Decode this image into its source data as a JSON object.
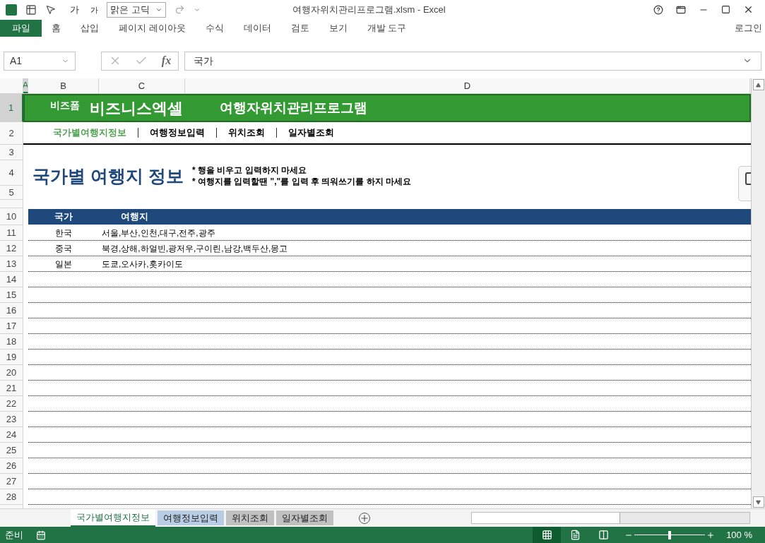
{
  "window": {
    "title": "여행자위치관리프로그램.xlsm - Excel",
    "font_box": "맑은 고딕",
    "font_size_up": "가",
    "font_size_down": "가"
  },
  "ribbon": {
    "tabs": [
      {
        "label": "파일",
        "kind": "file"
      },
      {
        "label": "홈",
        "kind": "tab"
      },
      {
        "label": "삽입",
        "kind": "tab"
      },
      {
        "label": "페이지 레이아웃",
        "kind": "tab"
      },
      {
        "label": "수식",
        "kind": "tab"
      },
      {
        "label": "데이터",
        "kind": "tab"
      },
      {
        "label": "검토",
        "kind": "tab"
      },
      {
        "label": "보기",
        "kind": "tab"
      },
      {
        "label": "개발 도구",
        "kind": "tab"
      }
    ],
    "account": "로그인"
  },
  "formula_bar": {
    "name_box": "A1",
    "function_button": "fx",
    "value": "국가"
  },
  "columns": [
    {
      "label": "A",
      "selected": true
    },
    {
      "label": "B",
      "selected": false
    },
    {
      "label": "C",
      "selected": false
    },
    {
      "label": "D",
      "selected": false
    }
  ],
  "row_headers": [
    {
      "label": "1",
      "selected": true
    },
    {
      "label": "2",
      "selected": false
    },
    {
      "label": "3",
      "selected": false
    },
    {
      "label": "4",
      "selected": false
    },
    {
      "label": "5",
      "selected": false
    },
    {
      "label": "10",
      "selected": false
    }
  ],
  "banner": {
    "brand_small": "비즈폼",
    "brand": "비즈니스엑셀",
    "title": "여행자위치관리프로그램"
  },
  "nav": [
    {
      "label": "국가별여행지정보",
      "selected": true
    },
    {
      "label": "여행정보입력",
      "selected": false
    },
    {
      "label": "위치조회",
      "selected": false
    },
    {
      "label": "일자별조회",
      "selected": false
    }
  ],
  "heading": "국가별 여행지 정보",
  "notes": [
    "* 행을 비우고 입력하지 마세요",
    "* 여행지를 입력할땐 \",\"를 입력 후 띄워쓰기를 하지 마세요"
  ],
  "table": {
    "columns": [
      "국가",
      "여행지"
    ],
    "rows": [
      {
        "row_number": "11",
        "country": "한국",
        "places": "서울,부산,인천,대구,전주,광주"
      },
      {
        "row_number": "12",
        "country": "중국",
        "places": "북경,상해,하얼빈,광저우,구이린,남강,백두산,몽고"
      },
      {
        "row_number": "13",
        "country": "일본",
        "places": "도쿄,오사카,홋카이도"
      },
      {
        "row_number": "14"
      },
      {
        "row_number": "15"
      },
      {
        "row_number": "16"
      },
      {
        "row_number": "17"
      },
      {
        "row_number": "18"
      },
      {
        "row_number": "19"
      },
      {
        "row_number": "20"
      },
      {
        "row_number": "21"
      },
      {
        "row_number": "22"
      },
      {
        "row_number": "23"
      },
      {
        "row_number": "24"
      },
      {
        "row_number": "25"
      },
      {
        "row_number": "26"
      },
      {
        "row_number": "27"
      },
      {
        "row_number": "28"
      }
    ]
  },
  "sheet_tabs": [
    {
      "label": "국가별여행지정보",
      "selected": true,
      "color": "#ffffff"
    },
    {
      "label": "여행정보입력",
      "selected": false,
      "color": "#b8cce4"
    },
    {
      "label": "위치조회",
      "selected": false,
      "color": "#c0c0c0"
    },
    {
      "label": "일자별조회",
      "selected": false,
      "color": "#c0c0c0"
    }
  ],
  "status_bar": {
    "text": "준비",
    "zoom": "100 %",
    "level": 0.5,
    "views": [
      {
        "kind": "normal",
        "selected": true
      },
      {
        "kind": "page_layout",
        "selected": false
      },
      {
        "kind": "page_break",
        "selected": false
      }
    ]
  }
}
